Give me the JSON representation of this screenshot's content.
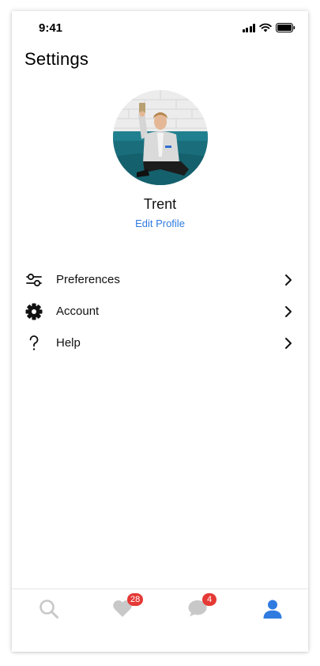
{
  "status_bar": {
    "time": "9:41"
  },
  "header": {
    "title": "Settings"
  },
  "profile": {
    "name": "Trent",
    "edit_label": "Edit Profile"
  },
  "menu": {
    "items": [
      {
        "label": "Preferences",
        "icon": "sliders-icon"
      },
      {
        "label": "Account",
        "icon": "gear-icon"
      },
      {
        "label": "Help",
        "icon": "question-mark-icon"
      }
    ]
  },
  "tab_bar": {
    "tabs": [
      {
        "icon": "search-icon",
        "badge": ""
      },
      {
        "icon": "heart-icon",
        "badge": "28"
      },
      {
        "icon": "chat-bubble-icon",
        "badge": "4"
      },
      {
        "icon": "person-icon",
        "badge": ""
      }
    ],
    "active_color": "#2f7be0",
    "inactive_color": "#c8c8c8",
    "badge_color": "#e53935"
  },
  "colors": {
    "link": "#2f7be0"
  }
}
